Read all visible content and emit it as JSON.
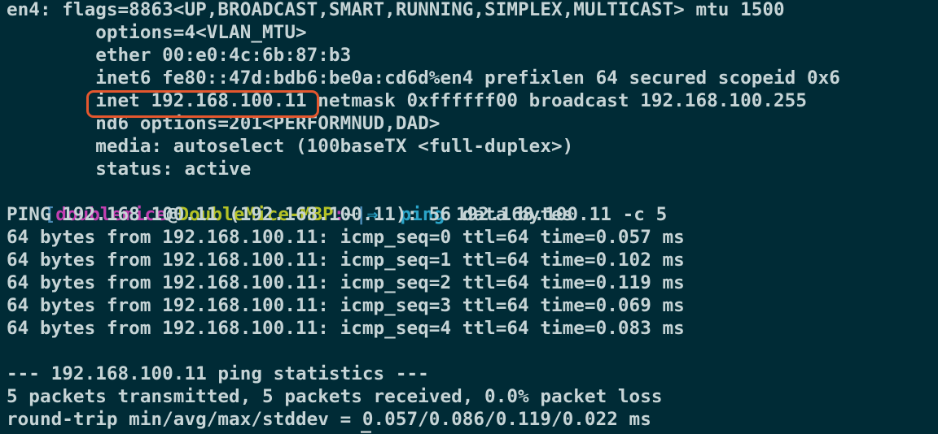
{
  "colors": {
    "background": "#002b36",
    "foreground": "#c6d4d6",
    "highlight_box": "#e4572e",
    "prompt_user": "#c33fb1",
    "prompt_host": "#b5c226",
    "prompt_arrow": "#2aa4c8"
  },
  "ifconfig": [
    "en4: flags=8863<UP,BROADCAST,SMART,RUNNING,SIMPLEX,MULTICAST> mtu 1500",
    "        options=4<VLAN_MTU>",
    "        ether 00:e0:4c:6b:87:b3",
    "        inet6 fe80::47d:bdb6:be0a:cd6d%en4 prefixlen 64 secured scopeid 0x6",
    "        inet 192.168.100.11 netmask 0xffffff00 broadcast 192.168.100.255",
    "        nd6 options=201<PERFORMNUD,DAD>",
    "        media: autoselect (100baseTX <full-duplex>)",
    "        status: active"
  ],
  "prompt": {
    "open_bracket": "[",
    "user": "doublemice",
    "at": "@",
    "host": "DoubleMice-MBP",
    "colon": ":",
    "path": "~",
    "separator": "|",
    "arrow": "⇒",
    "command": "ping",
    "arguments": "192.168.100.11 -c 5"
  },
  "ping_output": [
    "PING 192.168.100.11 (192.168.100.11): 56 data bytes",
    "64 bytes from 192.168.100.11: icmp_seq=0 ttl=64 time=0.057 ms",
    "64 bytes from 192.168.100.11: icmp_seq=1 ttl=64 time=0.102 ms",
    "64 bytes from 192.168.100.11: icmp_seq=2 ttl=64 time=0.119 ms",
    "64 bytes from 192.168.100.11: icmp_seq=3 ttl=64 time=0.069 ms",
    "64 bytes from 192.168.100.11: icmp_seq=4 ttl=64 time=0.083 ms"
  ],
  "statistics": [
    "--- 192.168.100.11 ping statistics ---",
    "5 packets transmitted, 5 packets received, 0.0% packet loss",
    "round-trip min/avg/max/stddev = 0.057/0.086/0.119/0.022 ms"
  ]
}
